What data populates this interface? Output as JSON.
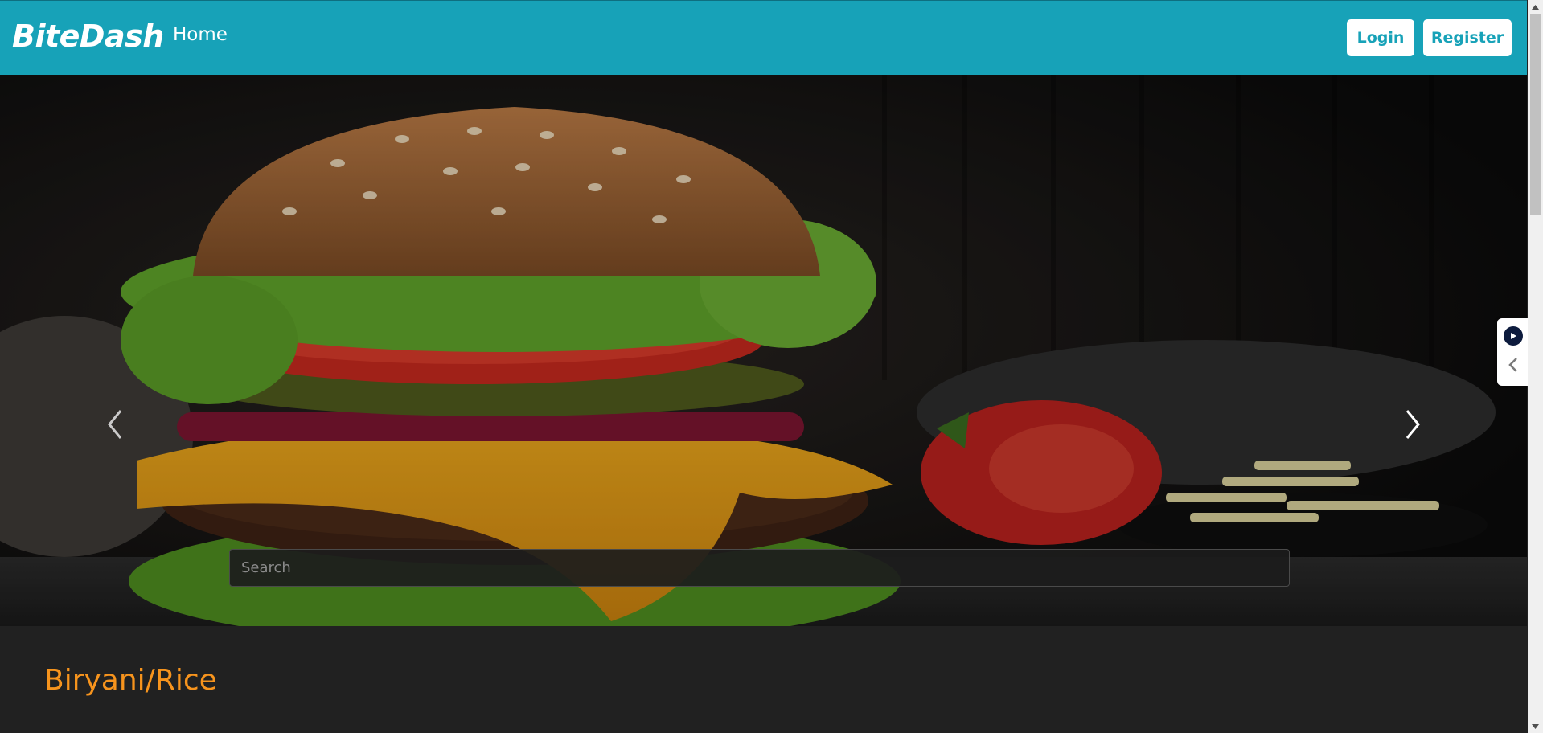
{
  "navbar": {
    "brand": "BiteDash",
    "links": [
      {
        "label": "Home"
      }
    ],
    "login_label": "Login",
    "register_label": "Register",
    "background_color": "#17a2b8"
  },
  "hero": {
    "image": "burger-food-photo",
    "prev_icon": "chevron-left-icon",
    "next_icon": "chevron-right-icon",
    "search": {
      "placeholder": "Search",
      "value": ""
    }
  },
  "side_widget": {
    "icons": [
      "play-icon",
      "chevron-left-icon"
    ]
  },
  "sections": [
    {
      "title": "Biryani/Rice",
      "title_color": "#f7941d"
    }
  ]
}
